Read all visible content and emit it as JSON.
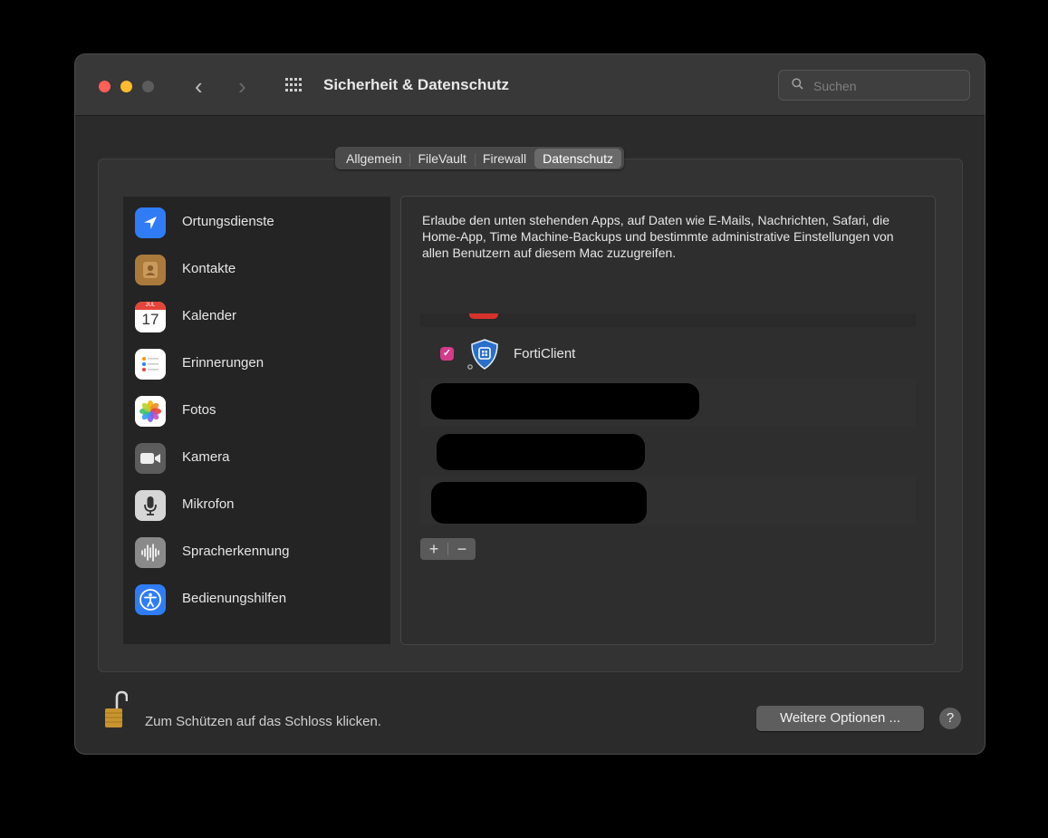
{
  "window": {
    "title": "Sicherheit & Datenschutz",
    "nav_back": "‹",
    "nav_forward": "›"
  },
  "search": {
    "placeholder": "Suchen"
  },
  "tabs": [
    {
      "label": "Allgemein",
      "active": false
    },
    {
      "label": "FileVault",
      "active": false
    },
    {
      "label": "Firewall",
      "active": false
    },
    {
      "label": "Datenschutz",
      "active": true
    }
  ],
  "sidebar": {
    "items": [
      {
        "label": "Ortungsdienste",
        "icon": "location-arrow-icon",
        "color": "#2f7cf6"
      },
      {
        "label": "Kontakte",
        "icon": "contacts-icon",
        "color": "#b08040"
      },
      {
        "label": "Kalender",
        "icon": "calendar-icon",
        "color": "#ffffff",
        "month": "JUL",
        "day": "17"
      },
      {
        "label": "Erinnerungen",
        "icon": "reminders-icon",
        "color": "#ffffff"
      },
      {
        "label": "Fotos",
        "icon": "photos-icon",
        "color": "#ffffff"
      },
      {
        "label": "Kamera",
        "icon": "camera-icon",
        "color": "#5c5c5c"
      },
      {
        "label": "Mikrofon",
        "icon": "microphone-icon",
        "color": "#d8d8d8"
      },
      {
        "label": "Spracherkennung",
        "icon": "waveform-icon",
        "color": "#8a8a8a"
      },
      {
        "label": "Bedienungshilfen",
        "icon": "accessibility-icon",
        "color": "#2f7cf6"
      }
    ]
  },
  "main": {
    "description": "Erlaube den unten stehenden Apps, auf Daten wie E-Mails, Nachrichten, Safari, die Home-App, Time Machine-Backups und bestimmte administrative Einstellungen von allen Benutzern auf diesem Mac zuzugreifen.",
    "apps": [
      {
        "name": "FortiClient",
        "checked": true,
        "icon": "forticlient-shield-icon",
        "check_mark": "✓"
      }
    ],
    "add_label": "+",
    "remove_label": "−"
  },
  "footer": {
    "lock_text": "Zum Schützen auf das Schloss klicken.",
    "more_options_label": "Weitere Optionen ...",
    "help_label": "?"
  },
  "colors": {
    "accent_checkbox": "#d43b8a",
    "tab_active": "#6a6a6a"
  }
}
